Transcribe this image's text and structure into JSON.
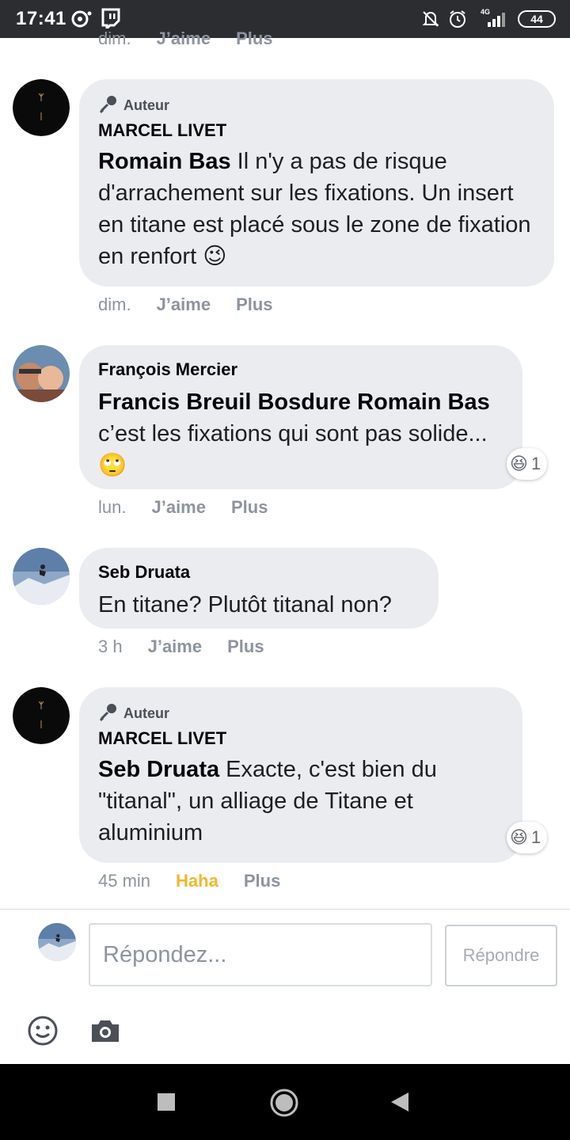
{
  "status_bar": {
    "time": "17:41",
    "network": "4G",
    "battery": "44"
  },
  "top_partial": {
    "time": "dim.",
    "like": "J’aime",
    "more": "Plus"
  },
  "comments": [
    {
      "badge": "Auteur",
      "author": "MARCEL LIVET",
      "mention": "Romain Bas",
      "text": " Il n'y a pas de risque d'arrachement sur les fixations. Un insert en titane est placé sous le zone de fixation en renfort",
      "emoji": "😉",
      "time": "dim.",
      "like": "J’aime",
      "more": "Plus",
      "avatar_text": "MARCEL LIVET"
    },
    {
      "author": "François Mercier",
      "mention": "Francis Breuil Bosdure Romain Bas",
      "text": "c’est les fixations qui sont pas solide...",
      "emoji": "🙄",
      "reaction_emoji": "😆",
      "reaction_count": "1",
      "time": "lun.",
      "like": "J’aime",
      "more": "Plus"
    },
    {
      "author": "Seb Druata",
      "text": "En titane? Plutôt titanal non?",
      "time": "3 h",
      "like": "J’aime",
      "more": "Plus"
    },
    {
      "badge": "Auteur",
      "author": "MARCEL LIVET",
      "mention": "Seb Druata",
      "text": " Exacte, c'est bien du \"titanal\", un alliage de Titane et aluminium",
      "reaction_emoji": "😆",
      "reaction_count": "1",
      "time": "45 min",
      "like": "Haha",
      "more": "Plus",
      "avatar_text": "MARCEL LIVET"
    }
  ],
  "reply": {
    "placeholder": "Répondez...",
    "button": "Répondre"
  },
  "colors": {
    "bubble": "#ebecf0",
    "haha": "#f0b72f",
    "muted": "#8d949e"
  }
}
